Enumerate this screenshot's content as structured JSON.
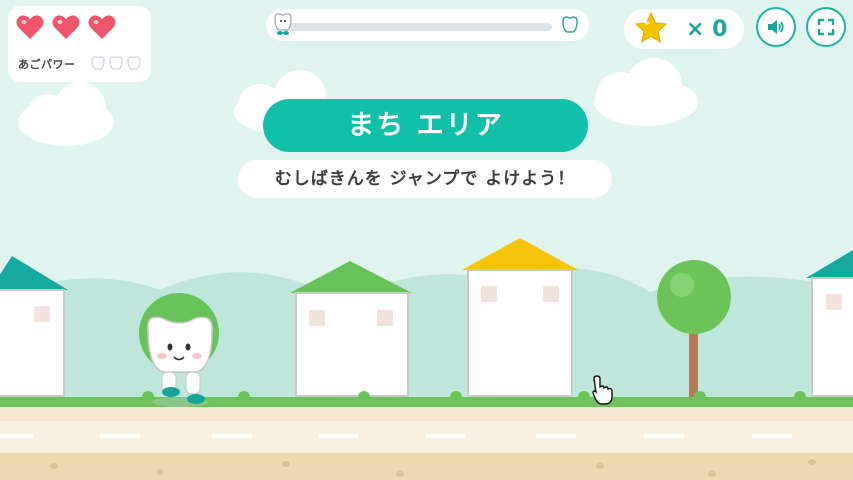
{
  "hud": {
    "lives": {
      "count": 3,
      "color": "#f0566b"
    },
    "jaw_power": {
      "label": "あごパワー",
      "slots_total": 3,
      "slots_filled": 0
    }
  },
  "progress": {
    "value": 0.0,
    "start_icon": "tooth-character-icon",
    "goal_icon": "tooth-outline-icon"
  },
  "stars": {
    "icon": "star-icon",
    "count_text": "× 0",
    "color": "#f5c400"
  },
  "buttons": {
    "sound_icon": "speaker-icon",
    "fullscreen_icon": "fullscreen-icon"
  },
  "stage": {
    "title": "まち エリア",
    "hint": "むしばきんを ジャンプで よけよう！",
    "accent": "#12bfa9"
  },
  "scene": {
    "player": "tooth-character",
    "cursor": "hand-pointer-icon",
    "colors": {
      "sky": "#dff3ef",
      "hill": "#bfe6da",
      "grass": "#6cc35a",
      "road": "#f6ecd9",
      "dirt": "#eed9b2"
    }
  }
}
